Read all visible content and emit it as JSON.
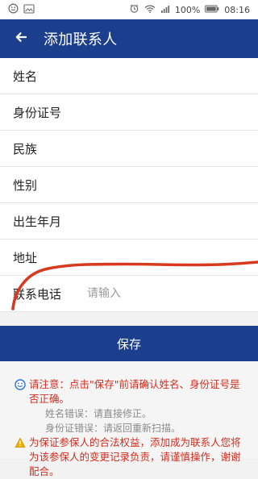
{
  "status": {
    "battery_percent": "100%",
    "time": "08:16",
    "icons": [
      "smile-icon",
      "image-icon",
      "alarm-icon",
      "wifi-icon",
      "signal-icon",
      "battery-icon"
    ]
  },
  "header": {
    "title": "添加联系人",
    "back_icon": "back-arrow-icon"
  },
  "form": {
    "rows": [
      {
        "label": "姓名"
      },
      {
        "label": "身份证号"
      },
      {
        "label": "民族"
      },
      {
        "label": "性别"
      },
      {
        "label": "出生年月"
      },
      {
        "label": "地址"
      },
      {
        "label": "联系电话",
        "placeholder": "请输入"
      }
    ]
  },
  "actions": {
    "save_label": "保存"
  },
  "notice": {
    "primary": "请注意：点击\"保存\"前请确认姓名、身份证号是否正确。",
    "name_error": "姓名错误：请直接修正。",
    "id_error": "身份证错误：请返回重新扫描。",
    "warning": "为保证参保人的合法权益，添加成为联系人您将为该参保人的变更记录负责，请谨慎操作，谢谢配合。",
    "colors": {
      "accent_blue": "#1b3f8c",
      "warning_red": "#d52b1e",
      "muted_gray": "#8a8a8a"
    }
  }
}
